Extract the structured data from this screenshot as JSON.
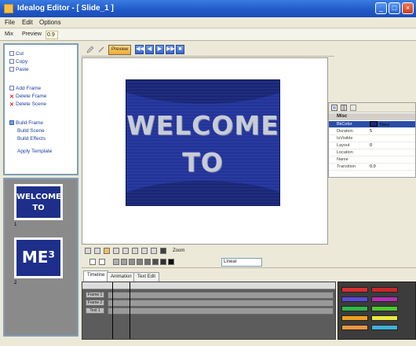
{
  "window": {
    "title": "Idealog Editor - [ Slide_1 ]",
    "controls": [
      "_",
      "□",
      "×"
    ]
  },
  "menu": [
    "File",
    "Edit",
    "Options"
  ],
  "modebar": {
    "label1": "Mix",
    "label2": "Preview",
    "field_value": "0.9"
  },
  "tasks": [
    {
      "label": "Cut",
      "icon": "document-icon"
    },
    {
      "label": "Copy",
      "icon": "document-icon"
    },
    {
      "label": "Paste",
      "icon": "document-icon"
    },
    {
      "label": "Add Frame",
      "icon": "document-icon"
    },
    {
      "label": "Delete Frame",
      "icon": "delete-icon"
    },
    {
      "label": "Delete Scene",
      "icon": "delete-icon"
    },
    {
      "label": "Build Frame",
      "icon": "group-icon"
    },
    {
      "label": "Build Scene",
      "icon": "none"
    },
    {
      "label": "Build Effects",
      "icon": "none"
    },
    {
      "label": "Apply Template",
      "icon": "none"
    }
  ],
  "slides": [
    {
      "line1": "WELCOME",
      "line2": "TO",
      "number": "1"
    },
    {
      "line1": "ME³",
      "line2": "",
      "number": "2"
    }
  ],
  "editor_toolbar": {
    "active_button": "Preview",
    "nav": [
      "◀◀",
      "◀",
      "▶",
      "▶▶",
      "■"
    ]
  },
  "slide_canvas": {
    "line1": "WELCOME",
    "line2": "TO",
    "background": "#23349a"
  },
  "properties": {
    "category": "Misc",
    "rows": [
      {
        "name": "BkColor",
        "value": "Navy",
        "selected": true
      },
      {
        "name": "Duration",
        "value": "5"
      },
      {
        "name": "IsVisible",
        "value": ""
      },
      {
        "name": "Layout",
        "value": "0"
      },
      {
        "name": "Location",
        "value": ""
      },
      {
        "name": "Name",
        "value": ""
      },
      {
        "name": "Transition",
        "value": "0.0"
      }
    ]
  },
  "timeline_toolbar": {
    "zoom_label": "Zoom",
    "dropdown_value": "Linear"
  },
  "tabs": [
    "Timeline",
    "Animation",
    "Text Edit"
  ],
  "timeline": {
    "track_labels": [
      "Frame 1",
      "Frame 2",
      "Text 1"
    ]
  },
  "palette": {
    "colors": [
      "#d83030",
      "#c82828",
      "#5a4ad8",
      "#b030b0",
      "#30b848",
      "#50c830",
      "#f0a020",
      "#e8e840",
      "#e89840",
      "#40b0d8"
    ]
  }
}
